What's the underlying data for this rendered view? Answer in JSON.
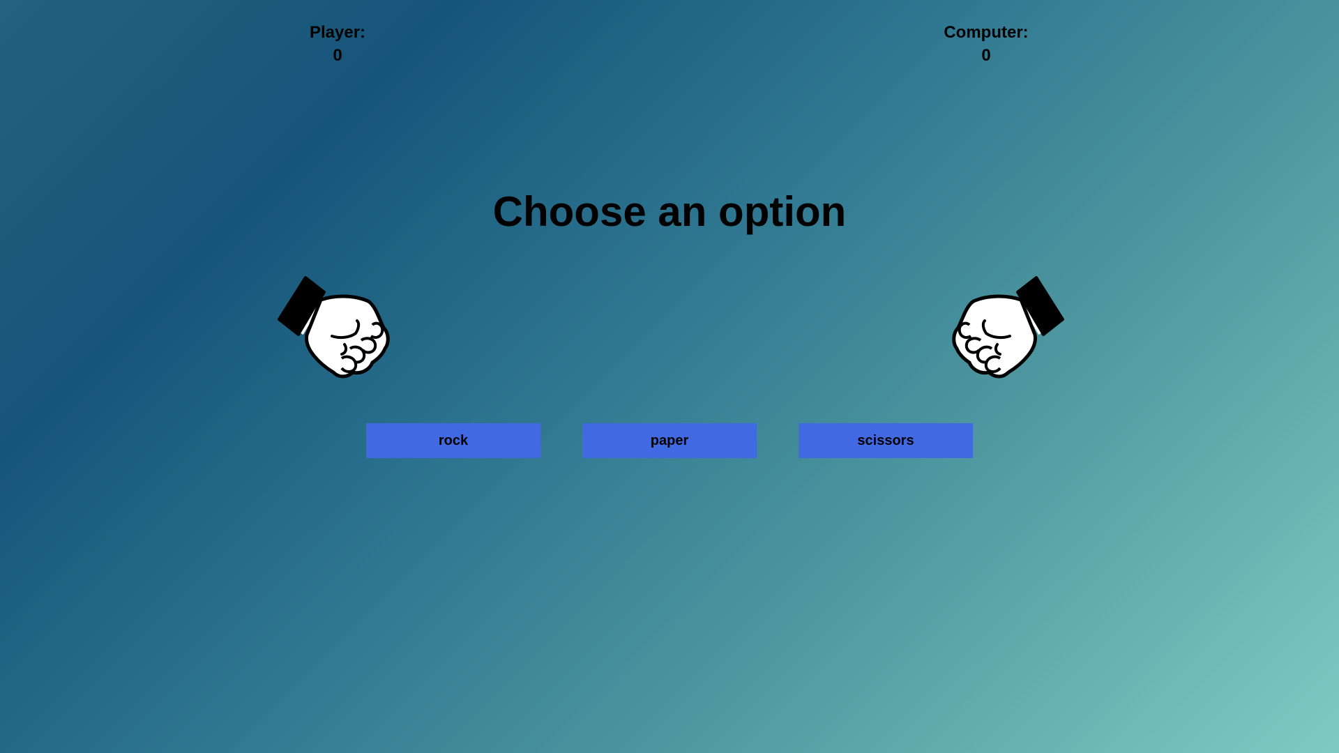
{
  "scoreboard": {
    "player_label": "Player:",
    "player_score": "0",
    "computer_label": "Computer:",
    "computer_score": "0"
  },
  "prompt": "Choose an option",
  "hands": {
    "player": "fist-icon",
    "computer": "fist-icon"
  },
  "choices": {
    "rock": "rock",
    "paper": "paper",
    "scissors": "scissors"
  },
  "colors": {
    "button": "#4169e1"
  }
}
